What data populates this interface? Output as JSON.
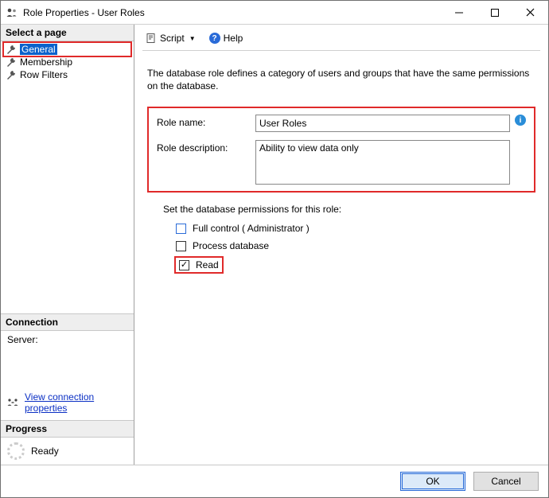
{
  "window": {
    "title": "Role Properties - User Roles"
  },
  "left": {
    "select_page": "Select a page",
    "pages": [
      "General",
      "Membership",
      "Row Filters"
    ],
    "connection_header": "Connection",
    "server_label": "Server:",
    "view_conn_props": "View connection properties",
    "progress_header": "Progress",
    "progress_status": "Ready"
  },
  "toolbar": {
    "script": "Script",
    "help": "Help"
  },
  "main": {
    "intro": "The database role defines a category of users and groups that have the same permissions on the database.",
    "role_name_label": "Role name:",
    "role_name_value": "User Roles",
    "role_desc_label": "Role description:",
    "role_desc_value": "Ability to view data only",
    "perm_title": "Set the database permissions for this role:",
    "perm_full": "Full control ( Administrator )",
    "perm_process": "Process database",
    "perm_read": "Read"
  },
  "footer": {
    "ok": "OK",
    "cancel": "Cancel"
  }
}
